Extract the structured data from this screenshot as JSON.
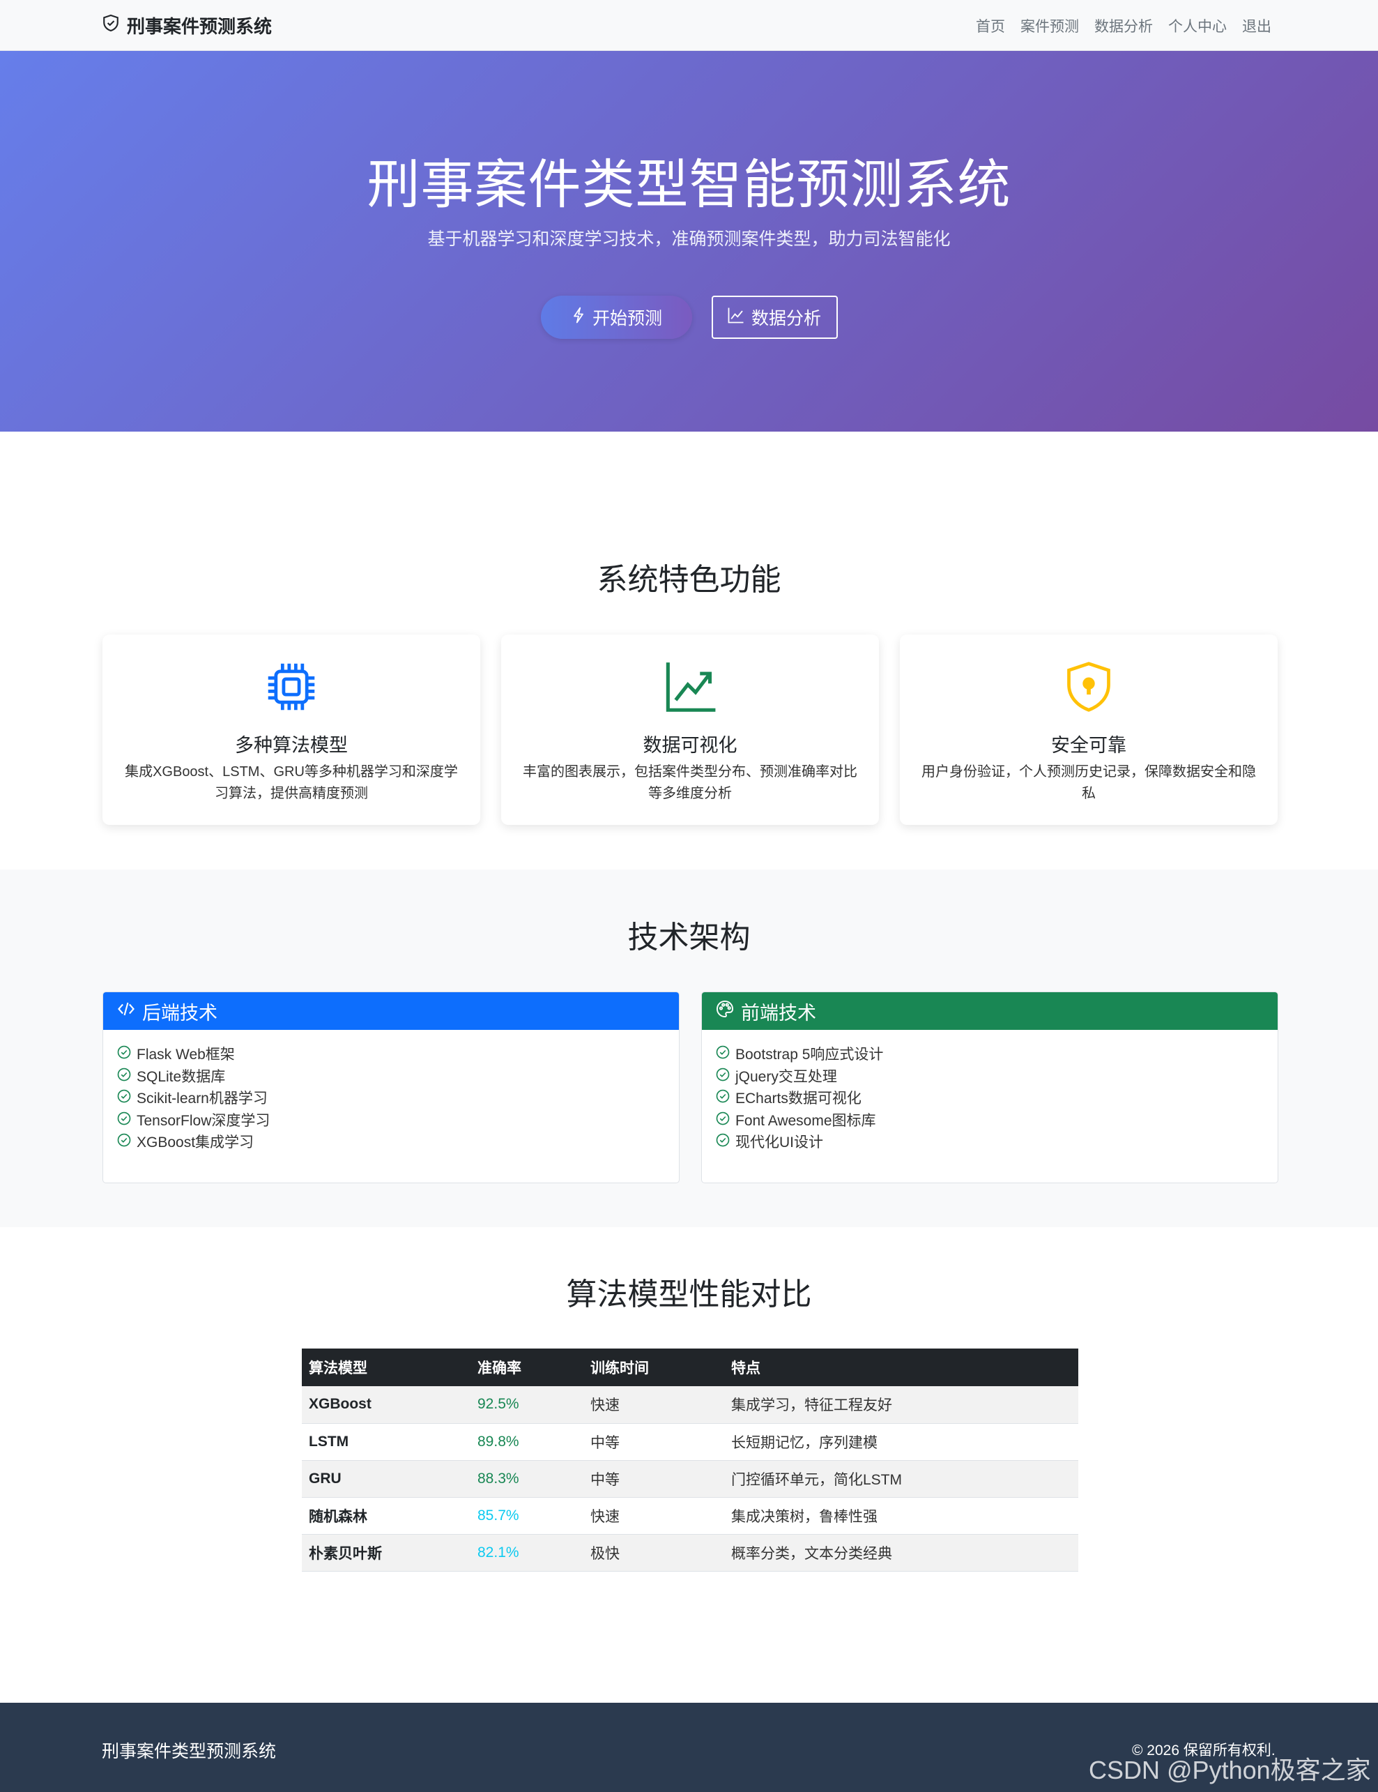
{
  "navbar": {
    "brand": "刑事案件预测系统",
    "links": [
      "首页",
      "案件预测",
      "数据分析",
      "个人中心",
      "退出"
    ]
  },
  "hero": {
    "title": "刑事案件类型智能预测系统",
    "subtitle": "基于机器学习和深度学习技术，准确预测案件类型，助力司法智能化",
    "primary_button": "开始预测",
    "secondary_button": "数据分析"
  },
  "features": {
    "title": "系统特色功能",
    "cards": [
      {
        "icon": "cpu-icon",
        "title": "多种算法模型",
        "desc": "集成XGBoost、LSTM、GRU等多种机器学习和深度学习算法，提供高精度预测"
      },
      {
        "icon": "graph-up-icon",
        "title": "数据可视化",
        "desc": "丰富的图表展示，包括案件类型分布、预测准确率对比等多维度分析"
      },
      {
        "icon": "shield-lock-icon",
        "title": "安全可靠",
        "desc": "用户身份验证，个人预测历史记录，保障数据安全和隐私"
      }
    ],
    "icon_colors": [
      "#0d6efd",
      "#198754",
      "#ffc107"
    ]
  },
  "tech": {
    "title": "技术架构",
    "backend": {
      "header": "后端技术",
      "color": "#0d6efd",
      "items": [
        "Flask Web框架",
        "SQLite数据库",
        "Scikit-learn机器学习",
        "TensorFlow深度学习",
        "XGBoost集成学习"
      ]
    },
    "frontend": {
      "header": "前端技术",
      "color": "#198754",
      "items": [
        "Bootstrap 5响应式设计",
        "jQuery交互处理",
        "ECharts数据可视化",
        "Font Awesome图标库",
        "现代化UI设计"
      ]
    }
  },
  "performance": {
    "title": "算法模型性能对比",
    "headers": [
      "算法模型",
      "准确率",
      "训练时间",
      "特点"
    ],
    "rows": [
      {
        "model": "XGBoost",
        "accuracy": "92.5%",
        "time": "快速",
        "feature": "集成学习，特征工程友好",
        "color": "#198754"
      },
      {
        "model": "LSTM",
        "accuracy": "89.8%",
        "time": "中等",
        "feature": "长短期记忆，序列建模",
        "color": "#198754"
      },
      {
        "model": "GRU",
        "accuracy": "88.3%",
        "time": "中等",
        "feature": "门控循环单元，简化LSTM",
        "color": "#198754"
      },
      {
        "model": "随机森林",
        "accuracy": "85.7%",
        "time": "快速",
        "feature": "集成决策树，鲁棒性强",
        "color": "#0dcaf0"
      },
      {
        "model": "朴素贝叶斯",
        "accuracy": "82.1%",
        "time": "极快",
        "feature": "概率分类，文本分类经典",
        "color": "#0dcaf0"
      }
    ]
  },
  "footer": {
    "name": "刑事案件类型预测系统",
    "copyright": "© 2026 保留所有权利."
  },
  "watermark": "CSDN @Python极客之家"
}
